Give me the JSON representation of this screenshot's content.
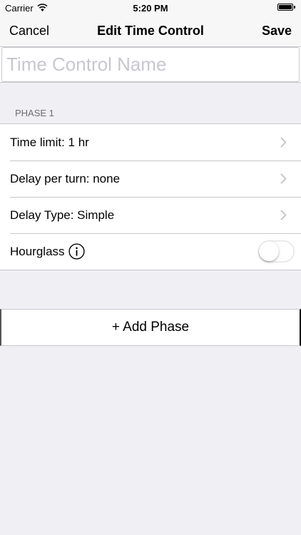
{
  "status_bar": {
    "carrier": "Carrier",
    "time": "5:20 PM"
  },
  "nav": {
    "cancel_label": "Cancel",
    "title": "Edit Time Control",
    "save_label": "Save"
  },
  "name_field": {
    "value": "",
    "placeholder": "Time Control Name"
  },
  "phase": {
    "header": "PHASE 1",
    "rows": [
      {
        "label": "Time limit: 1 hr"
      },
      {
        "label": "Delay per turn: none"
      },
      {
        "label": "Delay Type: Simple"
      }
    ],
    "hourglass": {
      "label": "Hourglass",
      "enabled": false
    }
  },
  "add_phase_label": "+ Add Phase",
  "colors": {
    "background": "#efeff4",
    "separator": "#c8c7cc",
    "section_header": "#6d6d72",
    "chevron": "#c7c7cc",
    "placeholder": "#c7c7cd"
  }
}
